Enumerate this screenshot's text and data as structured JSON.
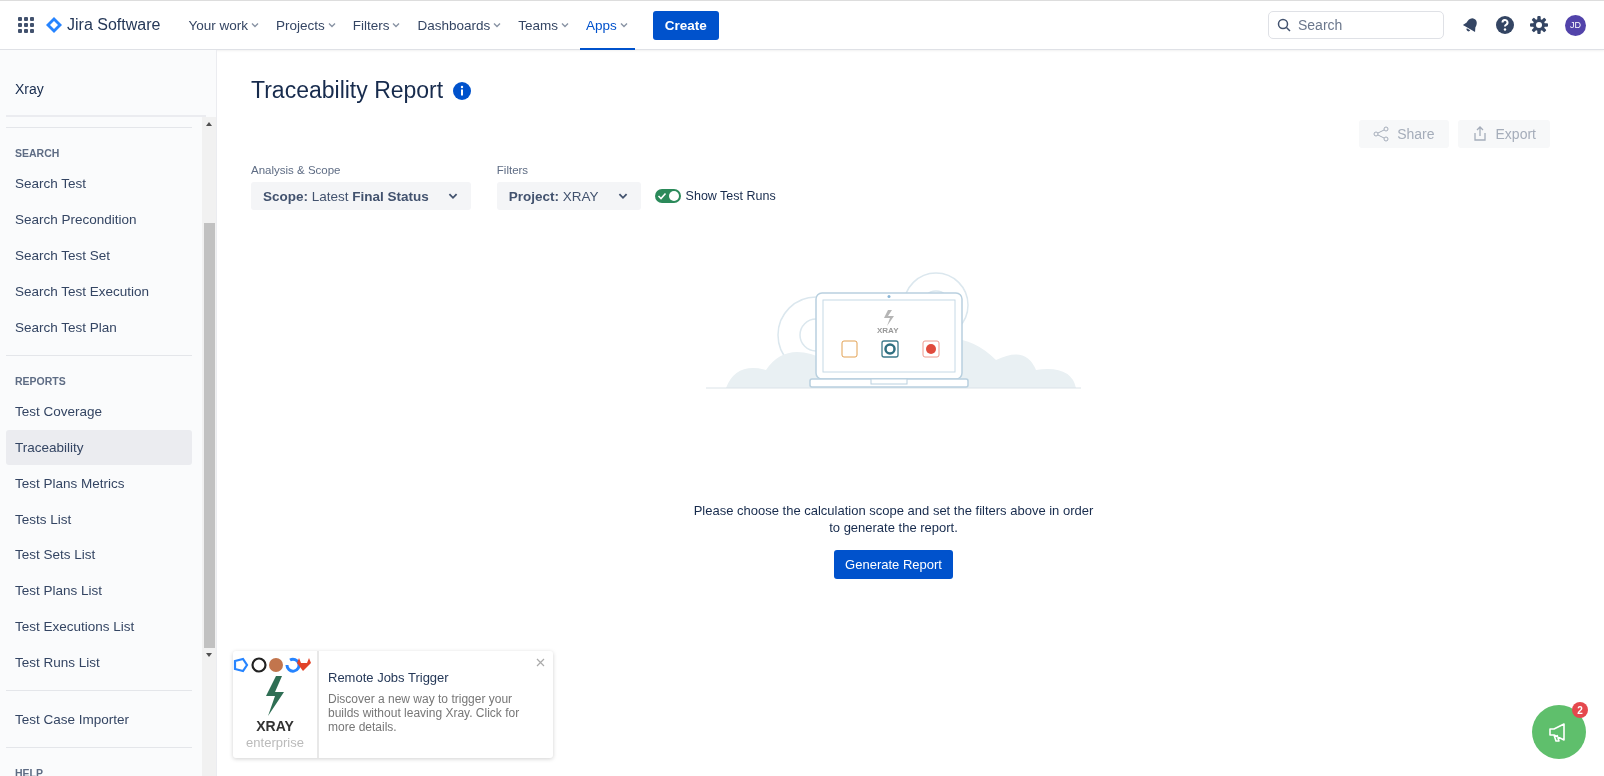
{
  "topnav": {
    "product": "Jira Software",
    "items": [
      {
        "label": "Your work",
        "selected": false
      },
      {
        "label": "Projects",
        "selected": false
      },
      {
        "label": "Filters",
        "selected": false
      },
      {
        "label": "Dashboards",
        "selected": false
      },
      {
        "label": "Teams",
        "selected": false
      },
      {
        "label": "Apps",
        "selected": true
      }
    ],
    "create": "Create",
    "search": {
      "placeholder": "Search"
    },
    "avatar": "JD"
  },
  "sidebar": {
    "title": "Xray",
    "sections": [
      {
        "heading": "SEARCH",
        "items": [
          {
            "label": "Search Test",
            "selected": false
          },
          {
            "label": "Search Precondition",
            "selected": false
          },
          {
            "label": "Search Test Set",
            "selected": false
          },
          {
            "label": "Search Test Execution",
            "selected": false
          },
          {
            "label": "Search Test Plan",
            "selected": false
          }
        ]
      },
      {
        "heading": "REPORTS",
        "items": [
          {
            "label": "Test Coverage",
            "selected": false
          },
          {
            "label": "Traceability",
            "selected": true
          },
          {
            "label": "Test Plans Metrics",
            "selected": false
          },
          {
            "label": "Tests List",
            "selected": false
          },
          {
            "label": "Test Sets List",
            "selected": false
          },
          {
            "label": "Test Plans List",
            "selected": false
          },
          {
            "label": "Test Executions List",
            "selected": false
          },
          {
            "label": "Test Runs List",
            "selected": false
          }
        ]
      },
      {
        "items": [
          {
            "label": "Test Case Importer",
            "selected": false
          }
        ]
      },
      {
        "heading": "HELP"
      }
    ]
  },
  "page": {
    "title": "Traceability Report",
    "actions": [
      {
        "label": "Share",
        "disabled": true
      },
      {
        "label": "Export",
        "disabled": true
      }
    ],
    "analysis": {
      "label": "Analysis & Scope",
      "value": "**Scope:** Latest **Final Status**"
    },
    "filters": {
      "label": "Filters",
      "value": "**Project:** XRAY"
    },
    "show_test_runs": {
      "label": "Show Test Runs",
      "on": true
    },
    "illustration": {
      "logo_text": "XRAY"
    },
    "message": "Please choose the calculation scope and set the filters above in order to generate the report.",
    "generate": "Generate Report"
  },
  "toast": {
    "logo_word": "XRAY",
    "logo_sub": "enterprise",
    "title": "Remote Jobs Trigger",
    "body": "Discover a new way to trigger your builds without leaving Xray. Click for more details."
  },
  "feedback": {
    "badge": "2"
  }
}
